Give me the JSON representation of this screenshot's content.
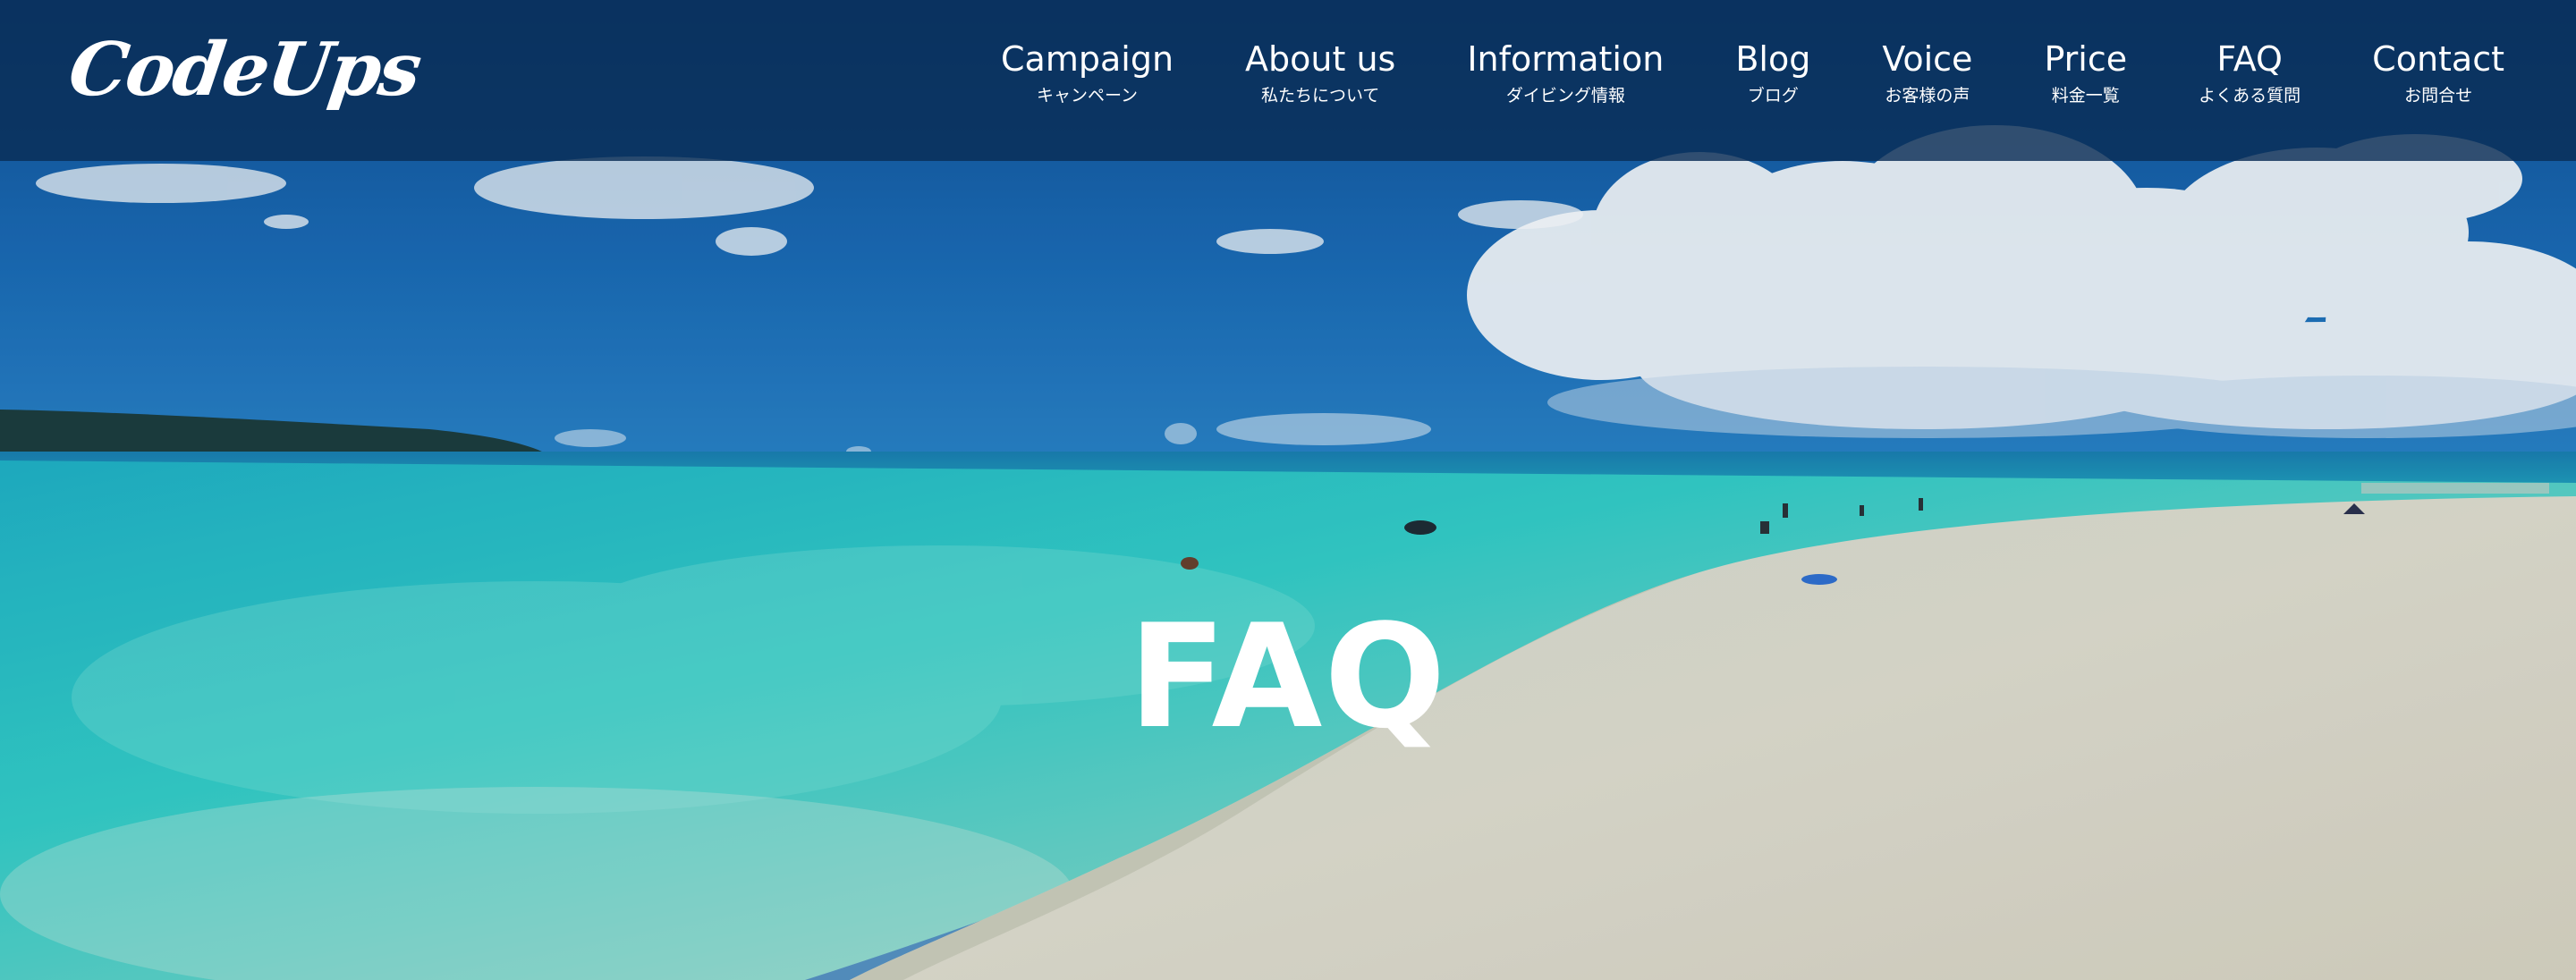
{
  "header": {
    "logo_text": "CodeUps",
    "nav": [
      {
        "en": "Campaign",
        "ja": "キャンペーン"
      },
      {
        "en": "About us",
        "ja": "私たちについて"
      },
      {
        "en": "Information",
        "ja": "ダイビング情報"
      },
      {
        "en": "Blog",
        "ja": "ブログ"
      },
      {
        "en": "Voice",
        "ja": "お客様の声"
      },
      {
        "en": "Price",
        "ja": "料金一覧"
      },
      {
        "en": "FAQ",
        "ja": "よくある質問"
      },
      {
        "en": "Contact",
        "ja": "お問合せ"
      }
    ]
  },
  "hero": {
    "title": "FAQ",
    "scene": "tropical-beach-photo"
  },
  "colors": {
    "header_bg": "#0a2d55",
    "sky": "#1a6bb5",
    "sea_turquoise": "#2ec9c6",
    "sand": "#e6e0cc",
    "text": "#ffffff"
  }
}
